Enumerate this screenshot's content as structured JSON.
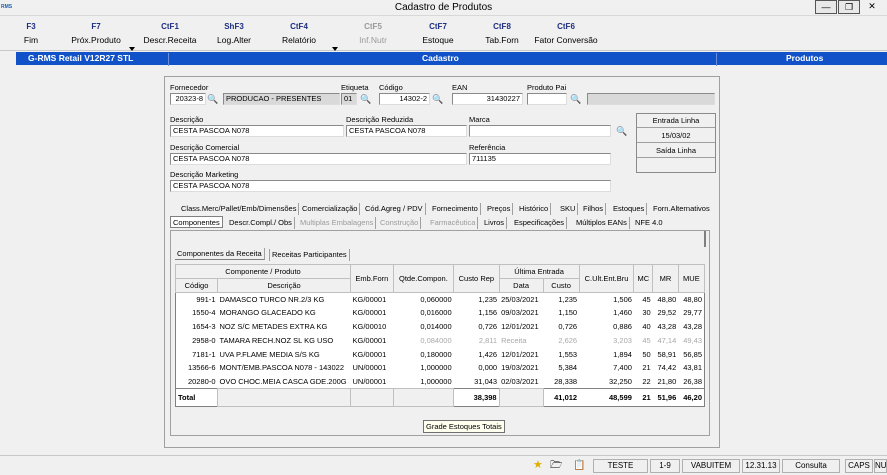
{
  "window": {
    "title": "Cadastro de Produtos",
    "logo_text": "RMS"
  },
  "toolbar": [
    {
      "key": "F3",
      "label": "Fim",
      "enabled": true
    },
    {
      "key": "F7",
      "label": "Próx.Produto",
      "enabled": true
    },
    {
      "key": "CtF1",
      "label": "Descr.Receita",
      "enabled": true
    },
    {
      "key": "ShF3",
      "label": "Log.Alter",
      "enabled": true
    },
    {
      "key": "CtF4",
      "label": "Relatório",
      "enabled": true
    },
    {
      "key": "CtF5",
      "label": "Inf.Nutr",
      "enabled": false
    },
    {
      "key": "CtF7",
      "label": "Estoque",
      "enabled": true
    },
    {
      "key": "CtF8",
      "label": "Tab.Forn",
      "enabled": true
    },
    {
      "key": "CtF6",
      "label": "Fator Conversão",
      "enabled": true
    }
  ],
  "bluebar": {
    "app": "G-RMS Retail V12R27 STL",
    "screen": "Cadastro",
    "module": "Produtos"
  },
  "form": {
    "fornecedor_label": "Fornecedor",
    "fornecedor_code": "20323-8",
    "fornecedor_name": "PRODUCAO - PRESENTES",
    "etiqueta_label": "Etiqueta",
    "etiqueta": "01",
    "codigo_label": "Código",
    "codigo": "14302-2",
    "ean_label": "EAN",
    "ean": "31430227",
    "produto_pai_label": "Produto Pai",
    "produto_pai": "",
    "descricao_label": "Descrição",
    "descricao": "CESTA PASCOA N078",
    "desc_reduzida_label": "Descrição Reduzida",
    "desc_reduzida": "CESTA PASCOA N078",
    "marca_label": "Marca",
    "marca": "",
    "desc_comercial_label": "Descrição Comercial",
    "desc_comercial": "CESTA PASCOA N078",
    "referencia_label": "Referência",
    "referencia": "711135",
    "desc_marketing_label": "Descrição Marketing",
    "desc_marketing": "CESTA PASCOA N078"
  },
  "side": {
    "entrada_label": "Entrada Linha",
    "entrada_date": "15/03/02",
    "saida_label": "Saída Linha",
    "saida_date": ""
  },
  "tabs_row1": [
    "Class.Merc/Pallet/Emb/Dimensões",
    "Comercialização",
    "Cód.Agreg / PDV",
    "Fornecimento",
    "Preços",
    "Histórico",
    "SKU",
    "Filhos",
    "Estoques",
    "Forn.Alternativos"
  ],
  "tabs_row2": [
    {
      "label": "Componentes",
      "state": "active"
    },
    {
      "label": "Descr.Compl./ Obs",
      "state": "normal"
    },
    {
      "label": "Multiplas Embalagens",
      "state": "disabled"
    },
    {
      "label": "Construção",
      "state": "disabled"
    },
    {
      "label": "Farmacêutica",
      "state": "disabled"
    },
    {
      "label": "Livros",
      "state": "normal"
    },
    {
      "label": "Especificações",
      "state": "normal"
    },
    {
      "label": "Múltiplos EANs",
      "state": "normal"
    },
    {
      "label": "NFE 4.0",
      "state": "normal"
    }
  ],
  "subtabs": [
    "Componentes da Receita",
    "Receitas Participantes"
  ],
  "grid": {
    "group_header": "Componente / Produto",
    "col_codigo": "Código",
    "col_descricao": "Descrição",
    "col_emb": "Emb.Forn",
    "col_qtde": "Qtde.Compon.",
    "col_custo": "Custo Rep",
    "col_ultima": "Última Entrada",
    "col_data": "Data",
    "col_custo2": "Custo",
    "col_cult": "C.Ult.Ent.Bru",
    "col_mc": "MC",
    "col_mr": "MR",
    "col_mue": "MUE",
    "rows": [
      {
        "codigo": "991-1",
        "descricao": "DAMASCO TURCO NR.2/3 KG",
        "emb": "KG/00001",
        "qtde": "0,060000",
        "custo": "1,235",
        "data": "25/03/2021",
        "custo2": "1,235",
        "cult": "1,506",
        "mc": "45",
        "mr": "48,80",
        "mue": "48,80"
      },
      {
        "codigo": "1550-4",
        "descricao": "MORANGO GLACEADO KG",
        "emb": "KG/00001",
        "qtde": "0,016000",
        "custo": "1,156",
        "data": "09/03/2021",
        "custo2": "1,150",
        "cult": "1,460",
        "mc": "30",
        "mr": "29,52",
        "mue": "29,77"
      },
      {
        "codigo": "1654-3",
        "descricao": "NOZ S/C METADES EXTRA KG",
        "emb": "KG/00010",
        "qtde": "0,014000",
        "custo": "0,726",
        "data": "12/01/2021",
        "custo2": "0,726",
        "cult": "0,886",
        "mc": "40",
        "mr": "43,28",
        "mue": "43,28"
      },
      {
        "codigo": "2958-0",
        "descricao": "TAMARA RECH.NOZ SL KG USO",
        "emb": "KG/00001",
        "qtde": "0,084000",
        "custo": "2,811",
        "data": "Receita",
        "custo2": "2,626",
        "cult": "3,203",
        "mc": "45",
        "mr": "47,14",
        "mue": "49,43",
        "faded": true
      },
      {
        "codigo": "7181-1",
        "descricao": "UVA P.FLAME MEDIA S/S KG",
        "emb": "KG/00001",
        "qtde": "0,180000",
        "custo": "1,426",
        "data": "12/01/2021",
        "custo2": "1,553",
        "cult": "1,894",
        "mc": "50",
        "mr": "58,91",
        "mue": "56,85"
      },
      {
        "codigo": "13566-6",
        "descricao": "MONT/EMB.PASCOA N078 - 143022",
        "emb": "UN/00001",
        "qtde": "1,000000",
        "custo": "0,000",
        "data": "19/03/2021",
        "custo2": "5,384",
        "cult": "7,400",
        "mc": "21",
        "mr": "74,42",
        "mue": "43,81"
      },
      {
        "codigo": "20280-0",
        "descricao": "OVO CHOC.MEIA CASCA GDE.200G",
        "emb": "UN/00001",
        "qtde": "1,000000",
        "custo": "31,043",
        "data": "02/03/2021",
        "custo2": "28,338",
        "cult": "32,250",
        "mc": "22",
        "mr": "21,80",
        "mue": "26,38"
      }
    ],
    "total_label": "Total",
    "total_custo": "38,398",
    "total_custo2": "41,012",
    "total_cult": "48,599",
    "total_mc": "21",
    "total_mr": "51,96",
    "total_mue": "46,20"
  },
  "tooltip": "Grade Estoques Totais",
  "statusbar": {
    "user": "TESTE",
    "range": "1-9",
    "store": "VABUITEM",
    "version": "12.31.13",
    "mode": "Consulta",
    "caps": "CAPS",
    "num": "NUI"
  }
}
